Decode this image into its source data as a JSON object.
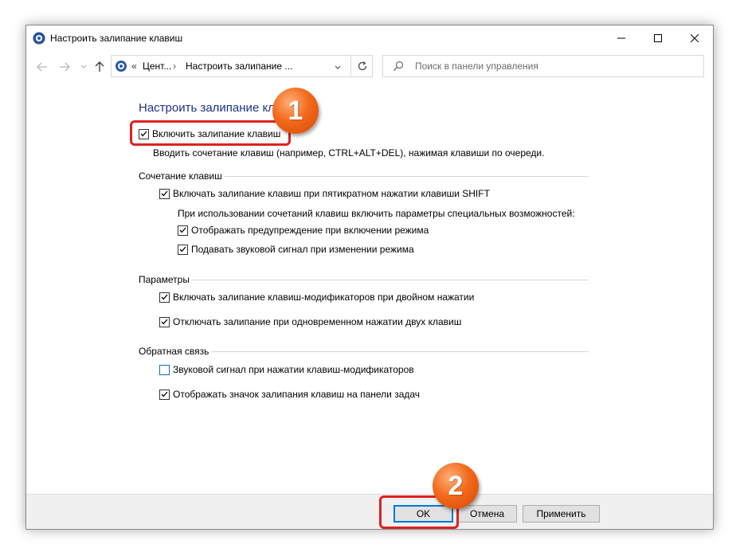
{
  "window": {
    "title": "Настроить залипание клавиш",
    "controls": {
      "minimize": "minimize",
      "maximize": "maximize",
      "close": "close"
    }
  },
  "navigation": {
    "address": {
      "overflow": "«",
      "crumbs": [
        "Цент...",
        "Настроить залипание ..."
      ],
      "separator": "›"
    },
    "search_placeholder": "Поиск в панели управления"
  },
  "content": {
    "heading": "Настроить залипание клавиш",
    "main_checkbox": {
      "label": "Включить залипание клавиш",
      "checked": true
    },
    "main_description": "Вводить сочетание клавиш (например, CTRL+ALT+DEL), нажимая клавиши по очереди.",
    "groups": {
      "shortcut": {
        "title": "Сочетание клавиш",
        "enable_shift": {
          "label": "Включать залипание клавиш при пятикратном нажатии клавиши SHIFT",
          "checked": true
        },
        "note": "При использовании сочетаний клавиш включить параметры специальных возможностей:",
        "show_warning": {
          "label": "Отображать предупреждение при включении режима",
          "checked": true
        },
        "play_sound": {
          "label": "Подавать звуковой сигнал при изменении режима",
          "checked": true
        }
      },
      "options": {
        "title": "Параметры",
        "double_press": {
          "label": "Включать залипание клавиш-модификаторов при двойном нажатии",
          "checked": true
        },
        "two_keys_off": {
          "label": "Отключать залипание при одновременном нажатии двух клавиш",
          "checked": true
        }
      },
      "feedback": {
        "title": "Обратная связь",
        "modifier_sound": {
          "label": "Звуковой сигнал при нажатии клавиш-модификаторов",
          "checked": false
        },
        "taskbar_icon": {
          "label": "Отображать значок залипания клавиш на панели задач",
          "checked": true
        }
      }
    }
  },
  "footer": {
    "ok": "OK",
    "cancel": "Отмена",
    "apply": "Применить"
  },
  "annotations": {
    "step1": "1",
    "step2": "2"
  },
  "colors": {
    "heading": "#1e3287",
    "highlight": "#e02020",
    "badge": "#f2691a",
    "default_button_border": "#0078d7"
  }
}
